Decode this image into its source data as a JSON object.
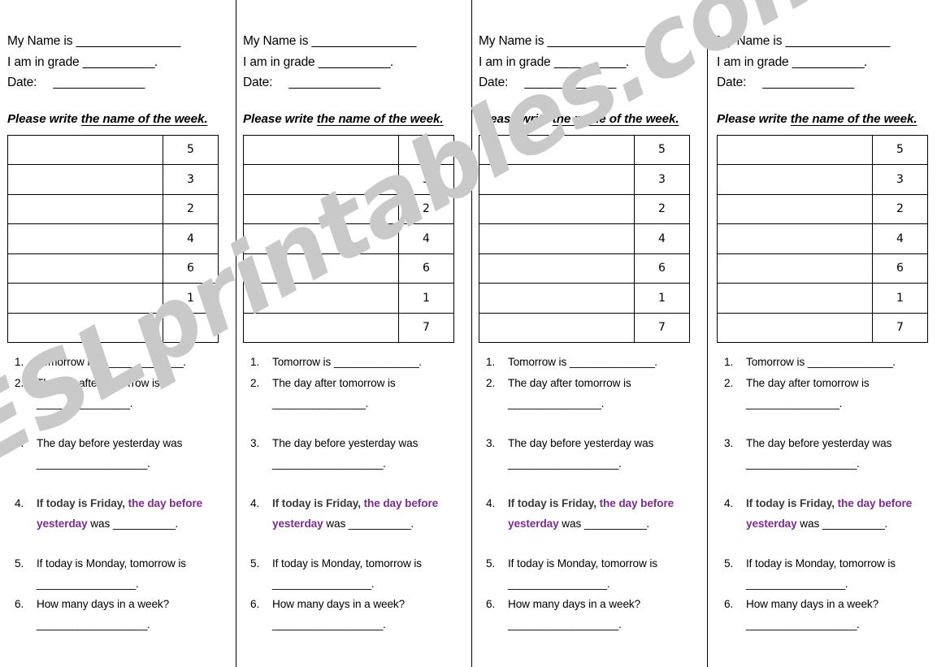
{
  "document": {
    "title": "Days of the Week Worksheet",
    "columns_count": 4,
    "accent_color": "#7b2d8e",
    "bold_color": "#3d3a3f",
    "watermark": {
      "text": "ESLprintables.com",
      "color": "#c9c9c9"
    }
  },
  "header": {
    "name_label": "My Name is",
    "name_blank": "________________",
    "grade_label": "I am in grade",
    "grade_blank": "___________",
    "grade_period": ".",
    "date_label": "Date:",
    "date_blank": "______________"
  },
  "instruction": {
    "plain": "Please write ",
    "underlined": "the name of the week."
  },
  "table": {
    "rows": [
      {
        "write": "",
        "number": "5"
      },
      {
        "write": "",
        "number": "3"
      },
      {
        "write": "",
        "number": "2"
      },
      {
        "write": "",
        "number": "4"
      },
      {
        "write": "",
        "number": "6"
      },
      {
        "write": "",
        "number": "1"
      },
      {
        "write": "",
        "number": "7"
      }
    ]
  },
  "questions": [
    {
      "number": "1.",
      "text": "Tomorrow is ",
      "inline_rule": "_______________.",
      "second_line": ""
    },
    {
      "number": "2.",
      "text": "The day after tomorrow is",
      "inline_rule": "",
      "second_line": "________________."
    },
    {
      "number": "3.",
      "text": "The day before yesterday was",
      "inline_rule": "",
      "second_line": "___________________."
    },
    {
      "number": "4.",
      "bold_lead": "If today is Friday, ",
      "accent": "the day before yesterday",
      "tail": " was ",
      "inline_rule": "___________.",
      "second_line": ""
    },
    {
      "number": "5.",
      "text": "If today is Monday, tomorrow is",
      "inline_rule": "",
      "second_line": "_________________."
    },
    {
      "number": "6.",
      "text": "How many days in a week?",
      "inline_rule": "",
      "second_line": "___________________."
    }
  ]
}
